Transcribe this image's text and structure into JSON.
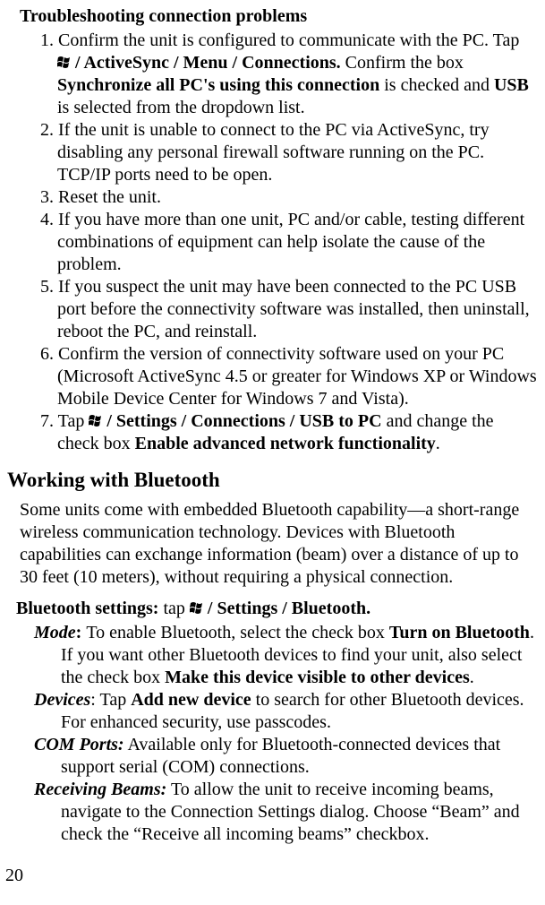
{
  "headings": {
    "troubleshoot": "Troubleshooting connection problems",
    "bluetooth": "Working with Bluetooth"
  },
  "steps": {
    "s1a": "Confirm the unit is configured to communicate with the PC. Tap ",
    "s1b": "/ ActiveSync / Menu / Connections.",
    "s1c": " Confirm the box ",
    "s1d": "Synchronize all PC's using this connection",
    "s1e": " is checked and ",
    "s1f": "USB",
    "s1g": " is selected from the dropdown list.",
    "s2": "If the unit is unable to connect to the PC via ActiveSync, try disabling any personal firewall software running on the PC. TCP/IP ports need to be open.",
    "s3": "Reset the unit.",
    "s4": "If you have more than one unit, PC and/or cable, testing different combinations of equipment can help isolate the cause of the problem.",
    "s5": "If you suspect the unit may have been connected to the PC USB port before the connectivity software was installed, then uninstall, reboot the PC, and reinstall.",
    "s6": "Confirm the version of connectivity software used on your PC (Microsoft ActiveSync 4.5 or greater for Windows XP or Windows Mobile Device Center for Windows 7 and Vista).",
    "s7a": "Tap ",
    "s7b": "/ Settings / Connections / USB to PC",
    "s7c": " and change the check box ",
    "s7d": "Enable advanced network functionality",
    "s7e": "."
  },
  "bluetooth_intro": "Some units come with embedded Bluetooth capability—a short-range wireless communication technology. Devices with Bluetooth capabilities can exchange information (beam) over a distance of up to 30 feet (10 meters), without requiring a physical connection.",
  "bt_settings": {
    "label": "Bluetooth settings:",
    "tap": " tap ",
    "path": "/ Settings / Bluetooth."
  },
  "bt_items": {
    "mode_h": "Mode",
    "mode_colon": ": ",
    "mode_a": "To enable Bluetooth, select the check box ",
    "mode_b": "Turn on Bluetooth",
    "mode_c": ". If you want other Bluetooth devices to find your unit, also select the check box ",
    "mode_d": "Make this device visible to other devices",
    "mode_e": ".",
    "devices_h": "Devices",
    "devices_colon": ": ",
    "devices_a": "Tap ",
    "devices_b": "Add new device",
    "devices_c": " to search for other Bluetooth devices. For enhanced security, use passcodes.",
    "com_h": "COM Ports:",
    "com_a": " Available only for Bluetooth-connected devices that support serial (COM) connections.",
    "beams_h": "Receiving Beams:",
    "beams_a": " To allow the unit to receive incoming beams, navigate to the Connection Settings dialog. Choose “Beam” and check the “Receive all incoming beams” checkbox."
  },
  "page_number": "20"
}
